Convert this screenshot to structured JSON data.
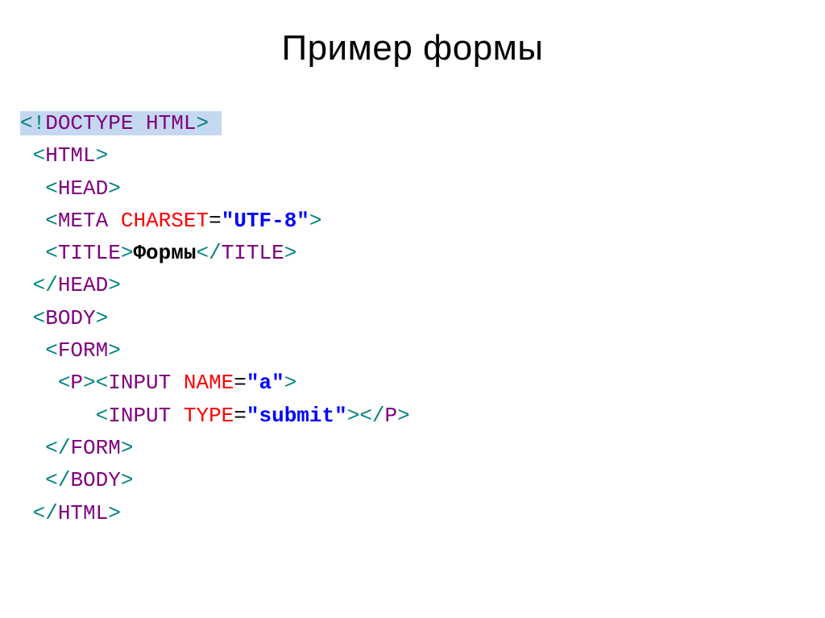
{
  "title": "Пример формы",
  "code": {
    "l1": {
      "open": "<!",
      "name": "DOCTYPE HTML",
      "close": ">",
      "trail": " "
    },
    "l2": {
      "open": "<",
      "name": "HTML",
      "close": ">"
    },
    "l3": {
      "open": "<",
      "name": "HEAD",
      "close": ">"
    },
    "l4": {
      "open": "<",
      "name": "META",
      "sp": " ",
      "attr": "CHARSET",
      "eq": "=",
      "val": "\"UTF-8\"",
      "close": ">"
    },
    "l5": {
      "open1": "<",
      "name1": "TITLE",
      "close1": ">",
      "text": "Формы",
      "open2": "</",
      "name2": "TITLE",
      "close2": ">"
    },
    "l6": {
      "open": "</",
      "name": "HEAD",
      "close": ">"
    },
    "l7": {
      "open": "<",
      "name": "BODY",
      "close": ">"
    },
    "l8": {
      "open": "<",
      "name": "FORM",
      "close": ">"
    },
    "l9": {
      "open1": "<",
      "name1": "P",
      "close1": "><",
      "name2": "INPUT",
      "sp": " ",
      "attr": "NAME",
      "eq": "=",
      "val": "\"a\"",
      "close2": ">"
    },
    "l10": {
      "open": "<",
      "name": "INPUT",
      "sp": " ",
      "attr": "TYPE",
      "eq": "=",
      "val": "\"submit\"",
      "close1": "></",
      "name2": "P",
      "close2": ">"
    },
    "l11": {
      "open": "</",
      "name": "FORM",
      "close": ">"
    },
    "l12": {
      "open": "</",
      "name": "BODY",
      "close": ">"
    },
    "l13": {
      "open": "</",
      "name": "HTML",
      "close": ">"
    }
  }
}
